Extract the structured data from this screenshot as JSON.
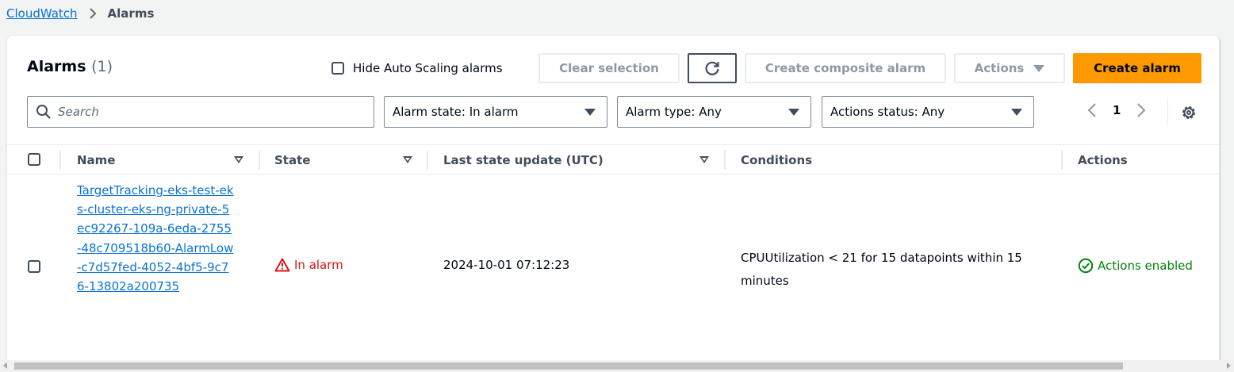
{
  "breadcrumb": {
    "root": "CloudWatch",
    "current": "Alarms"
  },
  "header": {
    "title": "Alarms",
    "count": "(1)",
    "hide_autoscaling_label": "Hide Auto Scaling alarms",
    "clear_selection": "Clear selection",
    "create_composite": "Create composite alarm",
    "actions": "Actions",
    "create_alarm": "Create alarm"
  },
  "filters": {
    "search_placeholder": "Search",
    "alarm_state": "Alarm state: In alarm",
    "alarm_type": "Alarm type: Any",
    "actions_status": "Actions status: Any"
  },
  "pagination": {
    "page": "1"
  },
  "table": {
    "columns": [
      "Name",
      "State",
      "Last state update (UTC)",
      "Conditions",
      "Actions"
    ],
    "rows": [
      {
        "name": "TargetTracking-eks-test-eks-cluster-eks-ng-private-5ec92267-109a-6eda-2755-48c709518b60-AlarmLow-c7d57fed-4052-4bf5-9c76-13802a200735",
        "state": "In alarm",
        "last_update": "2024-10-01 07:12:23",
        "conditions": "CPUUtilization < 21 for 15 datapoints within 15 minutes",
        "actions": "Actions enabled"
      }
    ]
  },
  "colors": {
    "link": "#0972d3",
    "primary": "#ff9900",
    "error": "#d91515",
    "success": "#037f0c"
  }
}
